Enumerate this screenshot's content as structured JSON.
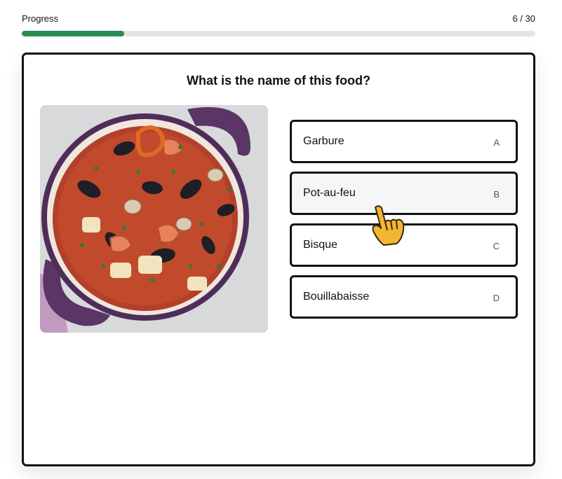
{
  "progress": {
    "label": "Progress",
    "counter": "6 / 30",
    "current": 6,
    "total": 30,
    "fill_color": "#2a8a4f"
  },
  "quiz": {
    "question": "What is the name of this food?",
    "image_icon": "food-photo-seafood-stew-in-purple-pot",
    "options": [
      {
        "text": "Garbure",
        "key": "A"
      },
      {
        "text": "Pot-au-feu",
        "key": "B",
        "hovered": true
      },
      {
        "text": "Bisque",
        "key": "C"
      },
      {
        "text": "Bouillabaisse",
        "key": "D"
      }
    ]
  },
  "cursor": {
    "icon": "pointing-hand-cursor-icon",
    "color": "#f2b632"
  }
}
